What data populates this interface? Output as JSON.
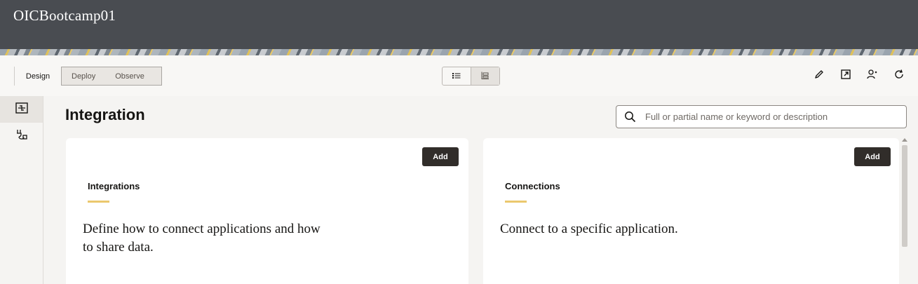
{
  "app": {
    "title": "OICBootcamp01"
  },
  "toolbar": {
    "tabs": [
      "Design",
      "Deploy",
      "Observe"
    ],
    "icons": [
      "list-view-icon",
      "card-view-icon",
      "edit-icon",
      "open-external-icon",
      "user-settings-icon",
      "refresh-icon"
    ]
  },
  "sidebar": {
    "items": [
      "integration-design-icon",
      "connections-plug-icon"
    ]
  },
  "main": {
    "title": "Integration",
    "search": {
      "placeholder": "Full or partial name or keyword or description",
      "value": ""
    }
  },
  "cards": [
    {
      "add_label": "Add",
      "title": "Integrations",
      "description": "Define how to connect applications and how to share data."
    },
    {
      "add_label": "Add",
      "title": "Connections",
      "description": "Connect to a specific application."
    }
  ],
  "colors": {
    "header": "#494c51",
    "accent_underline": "#ebc86e",
    "button_dark": "#312d2a"
  }
}
